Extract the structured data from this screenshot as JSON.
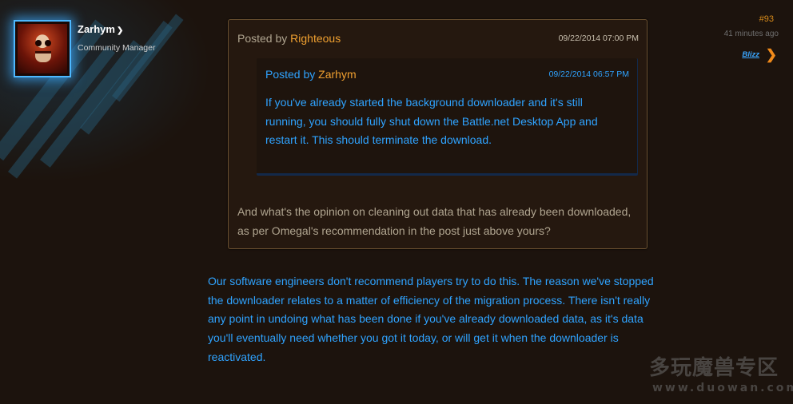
{
  "poster": {
    "name": "Zarhym",
    "title": "Community Manager",
    "chevron_icon": "chevron-down-icon",
    "avatar_icon": "skull-avatar"
  },
  "post_meta": {
    "number": "#93",
    "time": "41 minutes ago",
    "blizz_label": "Blizz",
    "next_icon": "chevron-right-icon",
    "accent_color": "#f08a1a"
  },
  "outer_quote": {
    "posted_by": "Posted by",
    "author": "Righteous",
    "date": "09/22/2014 07:00 PM",
    "body": "And what's the opinion on cleaning out data that has already been downloaded, as per Omegal's recommendation in the post just above yours?"
  },
  "inner_quote": {
    "posted_by": "Posted by",
    "author": "Zarhym",
    "date": "09/22/2014 06:57 PM",
    "body": "If you've already started the background downloader and it's still running, you should fully shut down the Battle.net Desktop App and restart it. This should terminate the download."
  },
  "reply": {
    "body": "Our software engineers don't recommend players try to do this. The reason we've stopped the downloader relates to a matter of efficiency of the migration process. There isn't really any point in undoing what has been done if you've already downloaded data, as it's data you'll eventually need whether you got it today, or will get it when the downloader is reactivated."
  },
  "watermark": {
    "site_name": "多玩魔兽专区",
    "site_url": "www.duowan.com"
  },
  "colors": {
    "blizz_blue": "#2fa3ff",
    "author_orange": "#f0a030",
    "background": "#1c130d"
  }
}
